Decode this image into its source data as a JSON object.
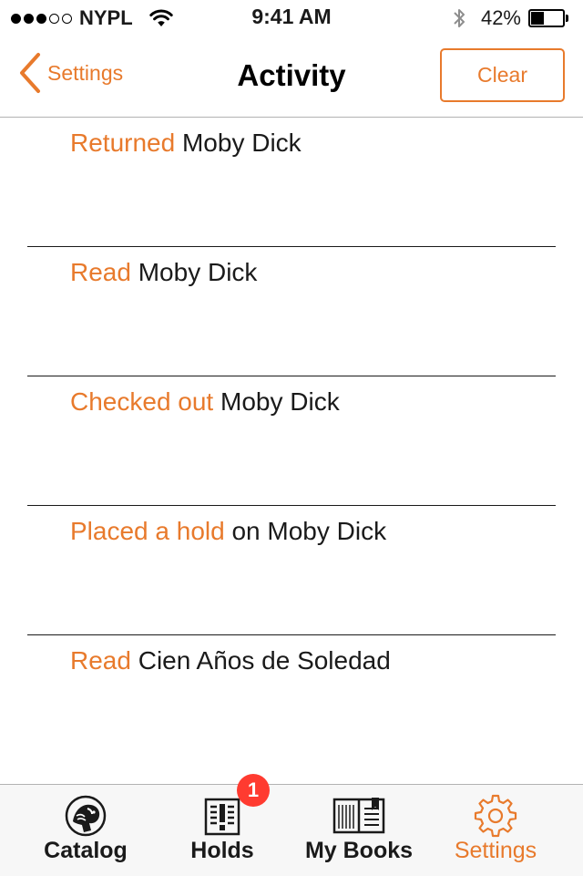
{
  "status_bar": {
    "carrier": "NYPL",
    "signal_bars_filled": 3,
    "signal_bars_total": 5,
    "time": "9:41 AM",
    "battery_percent": "42%",
    "battery_level": 0.42,
    "wifi_icon": "wifi-icon",
    "bluetooth_icon": "bluetooth-icon"
  },
  "nav": {
    "back_label": "Settings",
    "title": "Activity",
    "clear_label": "Clear"
  },
  "activities": [
    {
      "action": "Returned",
      "connector": "",
      "title": "Moby Dick"
    },
    {
      "action": "Read",
      "connector": "",
      "title": "Moby Dick"
    },
    {
      "action": "Checked out",
      "connector": "",
      "title": "Moby Dick"
    },
    {
      "action": "Placed a hold",
      "connector": "on",
      "title": "Moby Dick"
    },
    {
      "action": "Read",
      "connector": "",
      "title": "Cien Años de Soledad"
    }
  ],
  "tabs": [
    {
      "label": "Catalog",
      "icon": "lion-logo-icon",
      "active": false
    },
    {
      "label": "Holds",
      "icon": "holds-icon",
      "active": false,
      "badge": "1"
    },
    {
      "label": "My Books",
      "icon": "open-book-icon",
      "active": false
    },
    {
      "label": "Settings",
      "icon": "gear-icon",
      "active": true
    }
  ],
  "colors": {
    "accent": "#e87a2c",
    "badge": "#ff3b30",
    "text": "#1a1a1a"
  }
}
